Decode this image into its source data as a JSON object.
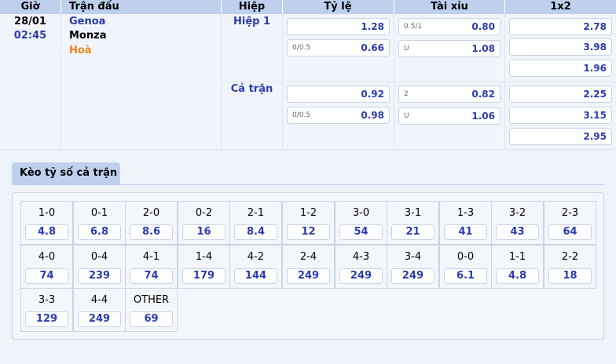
{
  "header": {
    "time": "Giờ",
    "match": "Trận đấu",
    "period": "Hiệp",
    "handicap": "Tỷ lệ",
    "over_under": "Tài xỉu",
    "one_x_two": "1x2"
  },
  "match": {
    "date": "28/01",
    "time": "02:45",
    "home": "Genoa",
    "away": "Monza",
    "draw": "Hoà"
  },
  "periods": [
    {
      "label": "Hiệp 1",
      "handicap": [
        {
          "line": "",
          "value": "1.28"
        },
        {
          "line": "0/0.5",
          "value": "0.66"
        }
      ],
      "over_under": [
        {
          "line": "0.5/1",
          "value": "0.80"
        },
        {
          "line": "U",
          "value": "1.08"
        }
      ],
      "one_x_two": [
        "2.78",
        "3.98",
        "1.96"
      ]
    },
    {
      "label": "Cả trận",
      "handicap": [
        {
          "line": "",
          "value": "0.92"
        },
        {
          "line": "0/0.5",
          "value": "0.98"
        }
      ],
      "over_under": [
        {
          "line": "2",
          "value": "0.82"
        },
        {
          "line": "U",
          "value": "1.06"
        }
      ],
      "one_x_two": [
        "2.25",
        "3.15",
        "2.95"
      ]
    }
  ],
  "score_tab": {
    "label": "Kèo tỷ số cả trận"
  },
  "scores": [
    {
      "score": "1-0",
      "odd": "4.8"
    },
    {
      "score": "0-1",
      "odd": "6.8"
    },
    {
      "score": "2-0",
      "odd": "8.6"
    },
    {
      "score": "0-2",
      "odd": "16"
    },
    {
      "score": "2-1",
      "odd": "8.4"
    },
    {
      "score": "1-2",
      "odd": "12"
    },
    {
      "score": "3-0",
      "odd": "54"
    },
    {
      "score": "3-1",
      "odd": "21"
    },
    {
      "score": "1-3",
      "odd": "41"
    },
    {
      "score": "3-2",
      "odd": "43"
    },
    {
      "score": "2-3",
      "odd": "64"
    },
    {
      "score": "4-0",
      "odd": "74"
    },
    {
      "score": "0-4",
      "odd": "239"
    },
    {
      "score": "4-1",
      "odd": "74"
    },
    {
      "score": "1-4",
      "odd": "179"
    },
    {
      "score": "4-2",
      "odd": "144"
    },
    {
      "score": "2-4",
      "odd": "249"
    },
    {
      "score": "4-3",
      "odd": "249"
    },
    {
      "score": "3-4",
      "odd": "249"
    },
    {
      "score": "0-0",
      "odd": "6.1"
    },
    {
      "score": "1-1",
      "odd": "4.8"
    },
    {
      "score": "2-2",
      "odd": "18"
    },
    {
      "score": "3-3",
      "odd": "129"
    },
    {
      "score": "4-4",
      "odd": "249"
    },
    {
      "score": "OTHER",
      "odd": "69"
    }
  ],
  "colors": {
    "header_bg": "#bfd0ee",
    "odds_text": "#2a3cb0",
    "home_team": "#2a3cb0",
    "away_team": "#000000",
    "draw": "#f0821e"
  }
}
